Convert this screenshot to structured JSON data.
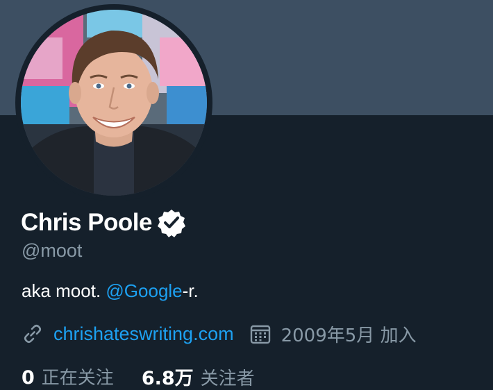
{
  "profile": {
    "display_name": "Chris Poole",
    "verified_icon": "verified-badge-icon",
    "handle": "@moot",
    "bio": {
      "prefix": "aka moot. ",
      "mention": "@Google",
      "suffix": "-r."
    },
    "website": "chrishateswriting.com",
    "joined": "2009年5月 加入"
  },
  "stats": {
    "following_count": "0",
    "following_label": "正在关注",
    "followers_count": "6.8万",
    "followers_label": "关注者"
  },
  "icons": {
    "link": "link-icon",
    "calendar": "calendar-icon"
  },
  "colors": {
    "background": "#15202b",
    "banner": "#3d4f62",
    "accent": "#1da1f2",
    "secondary_text": "#8899a6",
    "primary_text": "#ffffff"
  }
}
